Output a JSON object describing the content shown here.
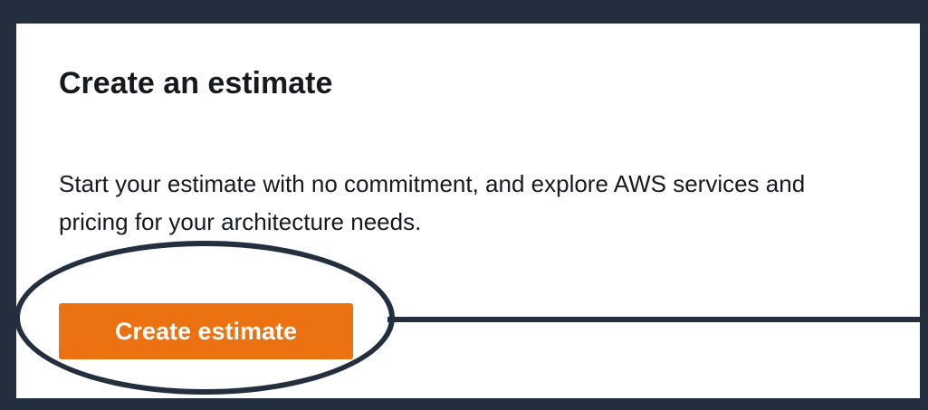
{
  "card": {
    "title": "Create an estimate",
    "description": "Start your estimate with no commitment, and explore AWS services and pricing for your architecture needs.",
    "button_label": "Create estimate"
  },
  "colors": {
    "frame": "#232f3e",
    "card_background": "#ffffff",
    "button_background": "#ec7211",
    "button_text": "#ffffff",
    "text": "#16191f"
  }
}
